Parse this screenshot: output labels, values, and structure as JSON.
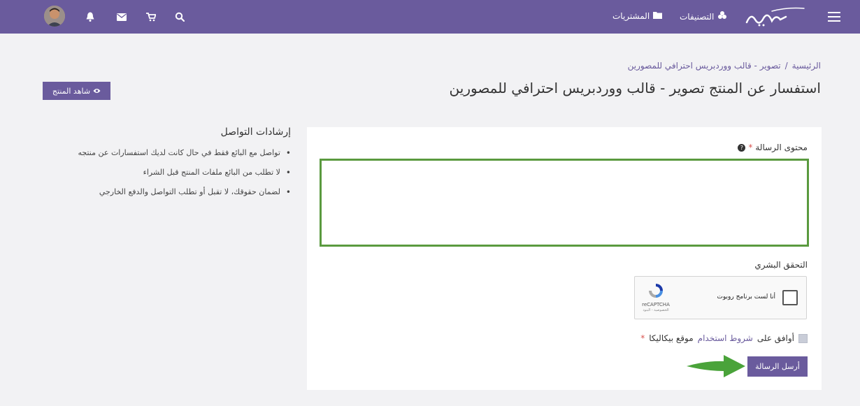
{
  "nav": {
    "categories": "التصنيفات",
    "purchases": "المشتريات"
  },
  "breadcrumb": {
    "home": "الرئيسية",
    "separator": "/",
    "current": "تصوير - قالب ووردبريس احترافي للمصورين"
  },
  "page": {
    "title": "استفسار عن المنتج تصوير - قالب ووردبريس احترافي للمصورين",
    "view_product": "شاهد المنتج"
  },
  "guidelines": {
    "heading": "إرشادات التواصل",
    "items": [
      "تواصل مع البائع فقط في حال كانت لديك استفسارات عن منتجه",
      "لا تطلب من البائع ملفات المنتج قبل الشراء",
      "لضمان حقوقك، لا تقبل أو تطلب التواصل والدفع الخارجي"
    ]
  },
  "form": {
    "message_label": "محتوى الرسالة",
    "required_mark": "*",
    "message_value": "",
    "captcha_label": "التحقق البشري",
    "recaptcha_text": "أنا لست برنامج روبوت",
    "recaptcha_brand": "reCAPTCHA",
    "recaptcha_terms": "الخصوصية - البنود",
    "agree_prefix": "أوافق على",
    "agree_link": "شروط استخدام",
    "agree_suffix": "موقع بيكاليكا",
    "submit": "أرسل الرسالة"
  },
  "colors": {
    "primary": "#6a5b9d",
    "highlight": "#5a9a3f",
    "required": "#d9534f"
  }
}
